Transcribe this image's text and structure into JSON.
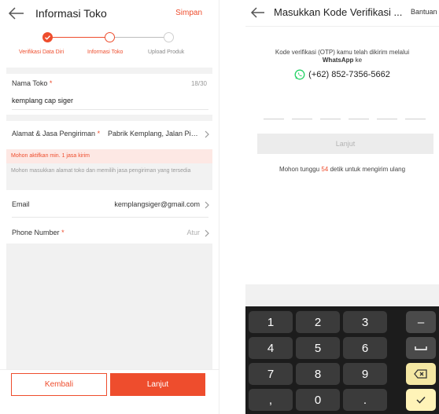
{
  "left": {
    "header": {
      "title": "Informasi Toko",
      "save_label": "Simpan"
    },
    "steps": [
      {
        "label": "Verifikasi Data Diri",
        "state": "done"
      },
      {
        "label": "Informasi Toko",
        "state": "current"
      },
      {
        "label": "Upload Produk",
        "state": "todo"
      }
    ],
    "store_name": {
      "label": "Nama Toko",
      "required_mark": "*",
      "counter": "18/30",
      "value": "kemplang cap siger"
    },
    "address": {
      "label": "Alamat & Jasa Pengiriman",
      "required_mark": "*",
      "value": "Pabrik Kemplang, Jalan Pia..."
    },
    "warning": "Mohon aktifkan min. 1 jasa kirim",
    "hint": "Mohon masukkan alamat toko dan memilih jasa pengiriman yang tersedia",
    "email": {
      "label": "Email",
      "value": "kemplangsiger@gmail.com"
    },
    "phone": {
      "label": "Phone Number",
      "required_mark": "*",
      "action": "Atur"
    },
    "buttons": {
      "back": "Kembali",
      "next": "Lanjut"
    }
  },
  "right": {
    "header": {
      "title": "Masukkan Kode Verifikasi ...",
      "help": "Bantuan"
    },
    "otp_message_line1": "Kode verifikasi (OTP) kamu telah dikirim melalui",
    "otp_message_channel": "WhatsApp",
    "otp_message_suffix": " ke",
    "phone_number": "(+62) 852-7356-5662",
    "next_label": "Lanjut",
    "wait_prefix": "Mohon tunggu ",
    "wait_seconds": "54",
    "wait_suffix": " detik untuk mengirim ulang",
    "keypad": {
      "row1": [
        "1",
        "2",
        "3"
      ],
      "row2": [
        "4",
        "5",
        "6"
      ],
      "row3": [
        "7",
        "8",
        "9"
      ],
      "row4": [
        ",",
        "0",
        "."
      ],
      "minus": "–"
    }
  },
  "colors": {
    "accent": "#ee4d2d",
    "whatsapp": "#25d366",
    "keyboard_bg": "#1c1c1c"
  }
}
